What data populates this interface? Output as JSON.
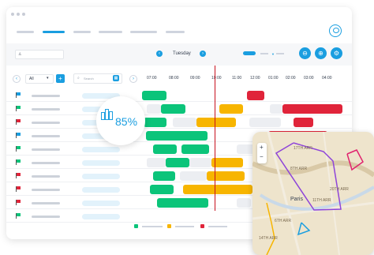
{
  "colors": {
    "blue": "#1a9ee0",
    "green": "#0bc47a",
    "orange": "#f7b500",
    "red": "#e0243a",
    "ghost": "#eceef2"
  },
  "toolbar": {
    "day_label": "Tuesday",
    "prev_icon": "chevron-left-icon",
    "next_icon": "chevron-right-icon"
  },
  "table": {
    "filter_value": "All",
    "search_placeholder": "Search",
    "times": [
      "07:00",
      "08:00",
      "09:00",
      "10:00",
      "11:00",
      "12:00",
      "01:00",
      "02:00",
      "03:00",
      "04:00"
    ]
  },
  "rows": [
    {
      "flag": "blue"
    },
    {
      "flag": "green"
    },
    {
      "flag": "red"
    },
    {
      "flag": "blue"
    },
    {
      "flag": "green"
    },
    {
      "flag": "green"
    },
    {
      "flag": "red"
    },
    {
      "flag": "red"
    },
    {
      "flag": "red"
    },
    {
      "flag": "green"
    }
  ],
  "badge": {
    "value": "85%",
    "icon": "bar-chart-icon"
  },
  "map": {
    "zoom_in": "+",
    "zoom_out": "−",
    "labels": [
      "17TH ARR",
      "8TH ARR",
      "Paris",
      "11TH ARR",
      "20TH ARR",
      "14TH ARR",
      "6TH ARR"
    ]
  },
  "header": {
    "user_icon": "user-icon"
  }
}
